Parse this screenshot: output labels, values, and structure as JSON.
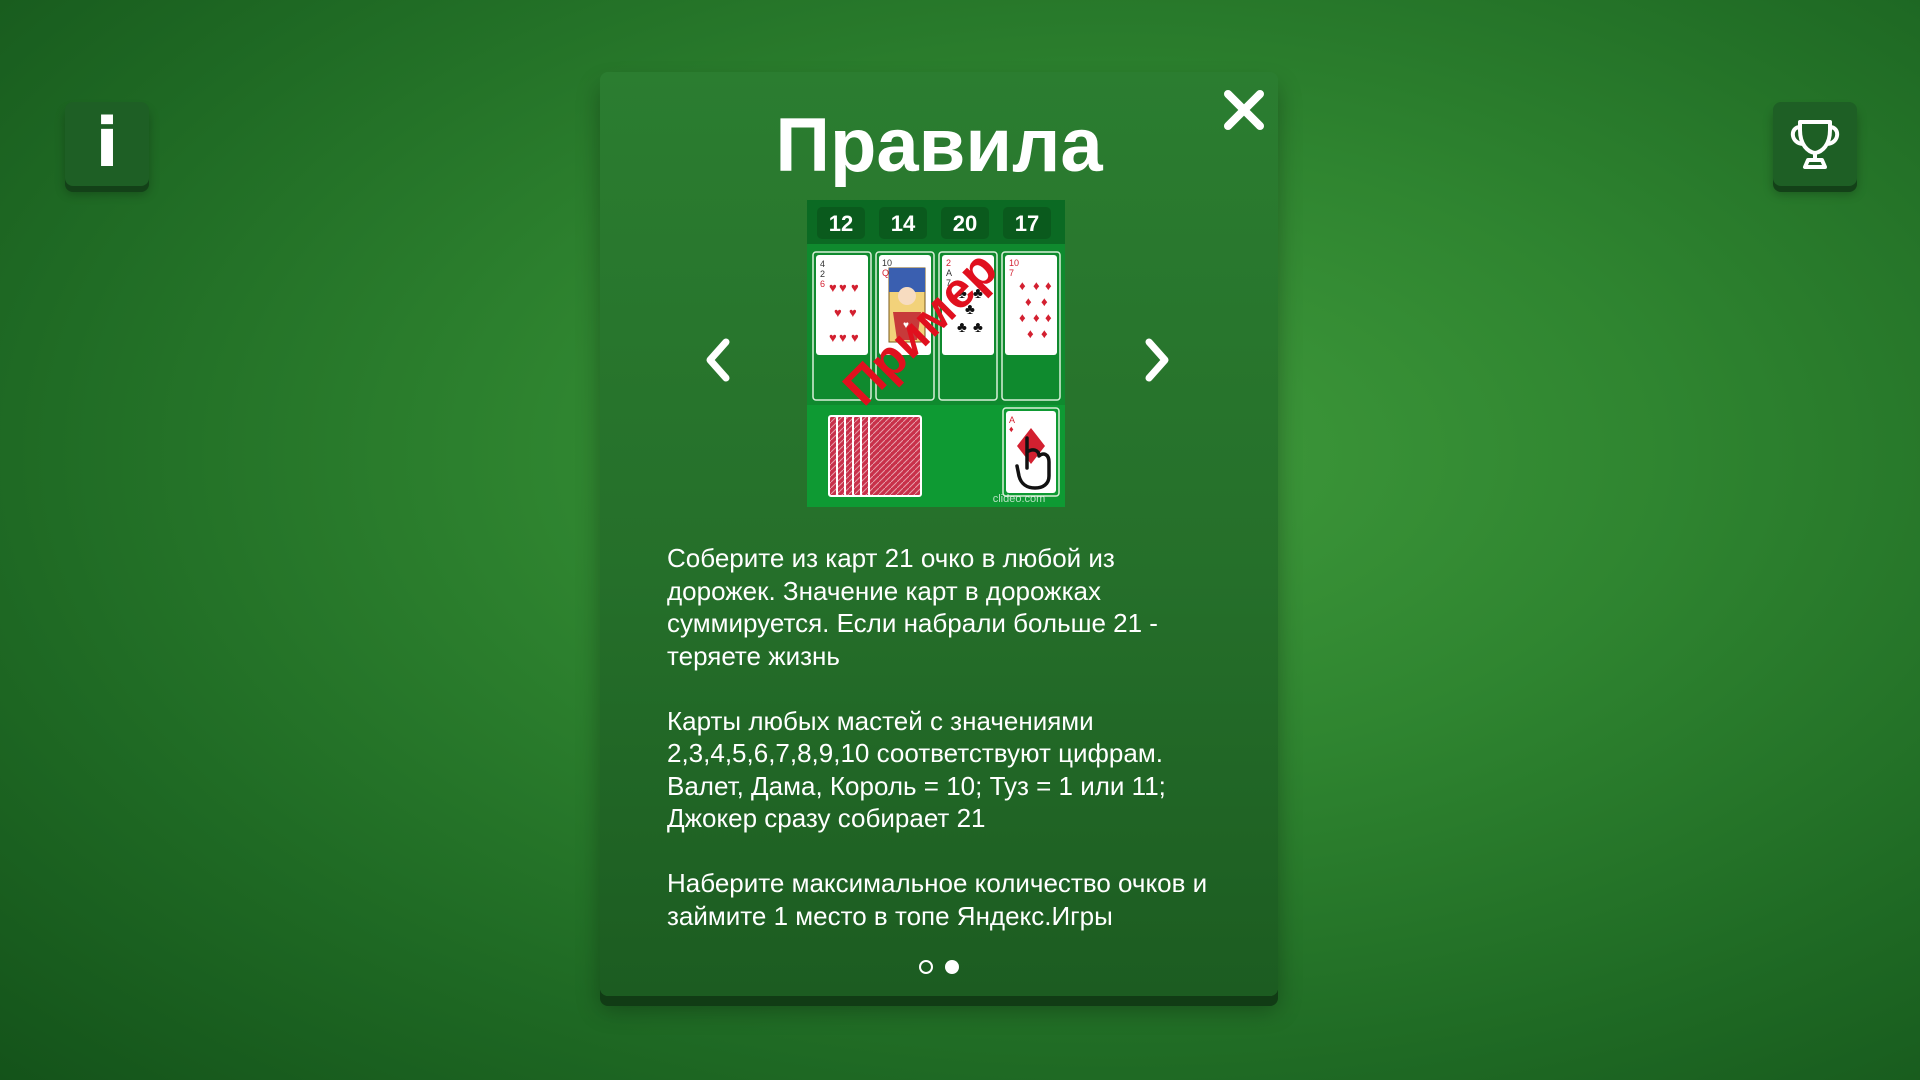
{
  "info_button": {
    "label": "i"
  },
  "trophy_button": {
    "icon": "trophy-icon"
  },
  "dialog": {
    "title": "Правила",
    "close_icon": "close-icon",
    "prev_icon": "chevron-left-icon",
    "next_icon": "chevron-right-icon",
    "preview": {
      "lane_scores": [
        "12",
        "14",
        "20",
        "17"
      ],
      "watermark": "Пример",
      "credit": "clideo.com"
    },
    "paragraphs": [
      " Соберите из карт 21 очко в любой из дорожек. Значение карт в дорожках суммируется. Если набрали больше 21 - теряете жизнь",
      " Карты любых мастей с значениями 2,3,4,5,6,7,8,9,10 соответствуют цифрам. Валет, Дама, Король = 10; Туз = 1 или 11; Джокер сразу собирает 21",
      " Наберите максимальное количество очков и займите 1 место в топе Яндекс.Игры"
    ],
    "pages_total": 2,
    "current_page": 2
  },
  "colors": {
    "table_green": "#2f8530",
    "dialog_green": "#256f2a",
    "button_dark_green": "#1e5f25",
    "card_red": "#d32030",
    "watermark_red": "#e0101e"
  }
}
